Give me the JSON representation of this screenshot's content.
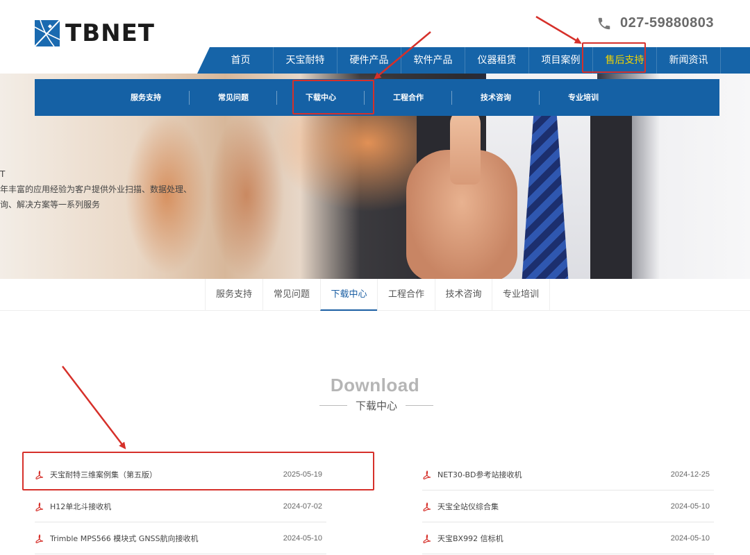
{
  "header": {
    "logo_text": "TBNET",
    "phone": "027-59880803"
  },
  "mainnav": {
    "items": [
      {
        "label": "首页",
        "width": 94
      },
      {
        "label": "天宝耐特",
        "width": 92
      },
      {
        "label": "硬件产品",
        "width": 92
      },
      {
        "label": "软件产品",
        "width": 92
      },
      {
        "label": "仪器租赁",
        "width": 92
      },
      {
        "label": "项目案例",
        "width": 92
      },
      {
        "label": "售后支持",
        "width": 92
      },
      {
        "label": "新闻资讯",
        "width": 92
      }
    ]
  },
  "submenu": {
    "items": [
      "服务支持",
      "常见问题",
      "下载中心",
      "工程合作",
      "技术咨询",
      "专业培训"
    ]
  },
  "hero": {
    "line1": "T",
    "line2": "年丰富的应用经验为客户提供外业扫描、数据处理、",
    "line3": "询、解决方案等一系列服务"
  },
  "tabs": {
    "items": [
      {
        "label": "服务支持",
        "width": 83
      },
      {
        "label": "常见问题",
        "width": 83
      },
      {
        "label": "下载中心",
        "width": 82
      },
      {
        "label": "工程合作",
        "width": 83
      },
      {
        "label": "技术咨询",
        "width": 82
      },
      {
        "label": "专业培训",
        "width": 84
      }
    ]
  },
  "section": {
    "title": "Download",
    "subtitle": "下载中心"
  },
  "downloads": {
    "left": [
      {
        "name": "天宝耐特三维案例集（第五版）",
        "date": "2025-05-19"
      },
      {
        "name": "H12单北斗接收机",
        "date": "2024-07-02"
      },
      {
        "name": "Trimble MPS566 模块式 GNSS航向接收机",
        "date": "2024-05-10"
      }
    ],
    "right": [
      {
        "name": "NET30-BD参考站接收机",
        "date": "2024-12-25"
      },
      {
        "name": "天宝全站仪综合集",
        "date": "2024-05-10"
      },
      {
        "name": "天宝BX992 信标机",
        "date": "2024-05-10"
      }
    ]
  },
  "colors": {
    "nav_blue": "#1664a8",
    "active_yellow": "#f3d400",
    "annotation_red": "#d6302a"
  }
}
